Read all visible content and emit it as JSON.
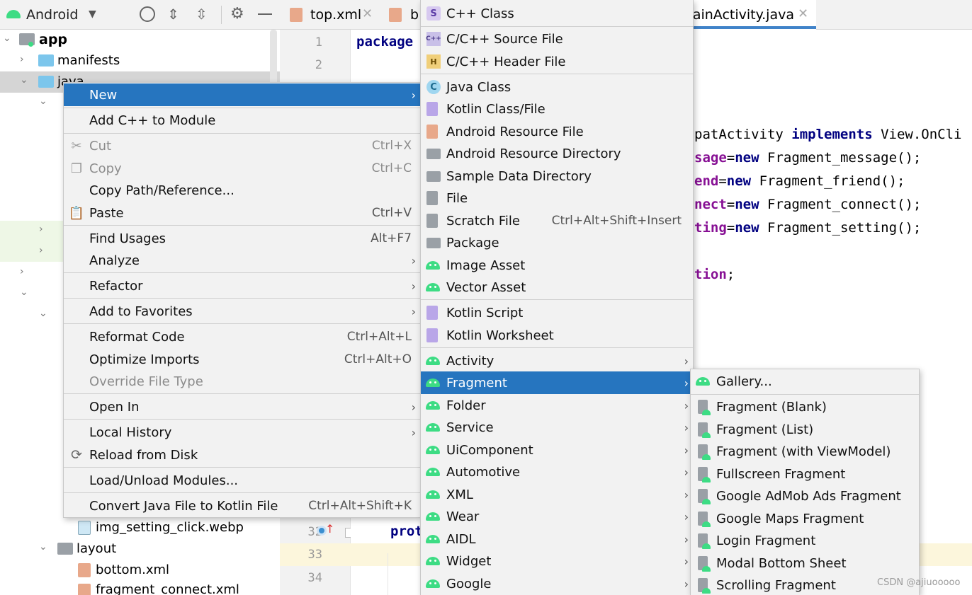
{
  "project_panel": {
    "view_selector": "Android",
    "tree": [
      {
        "label": "app",
        "bold": true
      },
      {
        "label": "manifests"
      },
      {
        "label": "java"
      },
      {
        "label": "img_setting_click.webp"
      },
      {
        "label": "layout"
      },
      {
        "label": "bottom.xml"
      },
      {
        "label": "fragment_connect.xml"
      }
    ]
  },
  "editor": {
    "tabs": [
      {
        "label": "top.xml"
      },
      {
        "label": "b"
      },
      {
        "label": "MainActivity.java",
        "active": true
      }
    ],
    "line_numbers": [
      "1",
      "2",
      "32",
      "33",
      "34"
    ],
    "code": {
      "line1": "package",
      "l_implements_pre": "patActivity ",
      "l_implements_kw": "implements",
      "l_implements_post": " View.OnCli",
      "l_msg_var": "sage",
      "l_msg_rest": "Fragment_message();",
      "l_friend_var": "end",
      "l_friend_rest": "Fragment_friend();",
      "l_connect_var": "nect",
      "l_connect_rest": "Fragment_connect();",
      "l_setting_var": "ting",
      "l_setting_rest": "Fragment_setting();",
      "l_tion": "tion",
      "l_semicolon": ";",
      "eq": "=",
      "kw_new": "new",
      "line32": "prot"
    }
  },
  "context_menu": {
    "items": [
      {
        "label": "New",
        "submenu": true,
        "selected": true
      },
      {
        "label": "Add C++ to Module"
      },
      {
        "label": "Cut",
        "shortcut": "Ctrl+X",
        "disabled": true,
        "icon": "cut-icon"
      },
      {
        "label": "Copy",
        "shortcut": "Ctrl+C",
        "disabled": true,
        "icon": "copy-icon"
      },
      {
        "label": "Copy Path/Reference..."
      },
      {
        "label": "Paste",
        "shortcut": "Ctrl+V",
        "icon": "paste-icon"
      },
      {
        "label": "Find Usages",
        "shortcut": "Alt+F7"
      },
      {
        "label": "Analyze",
        "submenu": true
      },
      {
        "label": "Refactor",
        "submenu": true
      },
      {
        "label": "Add to Favorites",
        "submenu": true
      },
      {
        "label": "Reformat Code",
        "shortcut": "Ctrl+Alt+L"
      },
      {
        "label": "Optimize Imports",
        "shortcut": "Ctrl+Alt+O"
      },
      {
        "label": "Override File Type",
        "disabled": true
      },
      {
        "label": "Open In",
        "submenu": true
      },
      {
        "label": "Local History",
        "submenu": true
      },
      {
        "label": "Reload from Disk",
        "icon": "reload-icon"
      },
      {
        "label": "Load/Unload Modules..."
      },
      {
        "label": "Convert Java File to Kotlin File",
        "shortcut": "Ctrl+Alt+Shift+K"
      }
    ]
  },
  "new_submenu": {
    "items": [
      {
        "label": "C++ Class"
      },
      {
        "label": "C/C++ Source File"
      },
      {
        "label": "C/C++ Header File"
      },
      {
        "label": "Java Class"
      },
      {
        "label": "Kotlin Class/File"
      },
      {
        "label": "Android Resource File"
      },
      {
        "label": "Android Resource Directory"
      },
      {
        "label": "Sample Data Directory"
      },
      {
        "label": "File"
      },
      {
        "label": "Scratch File",
        "shortcut": "Ctrl+Alt+Shift+Insert"
      },
      {
        "label": "Package"
      },
      {
        "label": "Image Asset"
      },
      {
        "label": "Vector Asset"
      },
      {
        "label": "Kotlin Script"
      },
      {
        "label": "Kotlin Worksheet"
      },
      {
        "label": "Activity",
        "submenu": true
      },
      {
        "label": "Fragment",
        "submenu": true,
        "selected": true
      },
      {
        "label": "Folder",
        "submenu": true
      },
      {
        "label": "Service",
        "submenu": true
      },
      {
        "label": "UiComponent",
        "submenu": true
      },
      {
        "label": "Automotive",
        "submenu": true
      },
      {
        "label": "XML",
        "submenu": true
      },
      {
        "label": "Wear",
        "submenu": true
      },
      {
        "label": "AIDL",
        "submenu": true
      },
      {
        "label": "Widget",
        "submenu": true
      },
      {
        "label": "Google",
        "submenu": true
      }
    ]
  },
  "fragment_submenu": {
    "items": [
      {
        "label": "Gallery..."
      },
      {
        "label": "Fragment (Blank)"
      },
      {
        "label": "Fragment (List)"
      },
      {
        "label": "Fragment (with ViewModel)"
      },
      {
        "label": "Fullscreen Fragment"
      },
      {
        "label": "Google AdMob Ads Fragment"
      },
      {
        "label": "Google Maps Fragment"
      },
      {
        "label": "Login Fragment"
      },
      {
        "label": "Modal Bottom Sheet"
      },
      {
        "label": "Scrolling Fragment"
      }
    ]
  },
  "watermark": "CSDN @ajiuooooo",
  "colors": {
    "accent": "#2675bf",
    "android_green": "#3ddc84",
    "keyword": "#000080",
    "field": "#871094"
  }
}
